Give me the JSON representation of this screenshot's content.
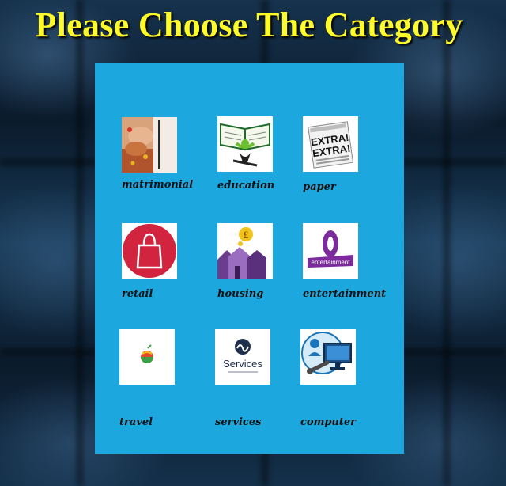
{
  "page": {
    "title": "Please Choose The Category"
  },
  "categories": [
    {
      "label": "matrimonial",
      "icon": "matrimonial-hands-icon"
    },
    {
      "label": "education",
      "icon": "open-book-icon"
    },
    {
      "label": "paper",
      "icon": "newspaper-icon"
    },
    {
      "label": "retail",
      "icon": "shopping-bag-icon"
    },
    {
      "label": "housing",
      "icon": "houses-icon"
    },
    {
      "label": "entertainment",
      "icon": "entertainment-logo-icon"
    },
    {
      "label": "travel",
      "icon": "globe-icon"
    },
    {
      "label": "services",
      "icon": "services-logo-icon"
    },
    {
      "label": "computer",
      "icon": "computer-repair-icon"
    }
  ],
  "thumb_texts": {
    "paper_line1": "EXTRA!",
    "paper_line2": "EXTRA!",
    "entertainment": "entertainment",
    "services": "Services",
    "housing_symbol": "£"
  },
  "colors": {
    "title": "#fffb2a",
    "panel": "#1ca7de",
    "label": "#111111"
  }
}
